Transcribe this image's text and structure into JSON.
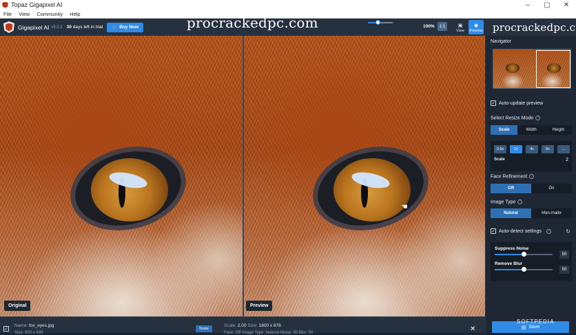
{
  "window": {
    "title": "Topaz Gigapixel AI",
    "controls": [
      "–",
      "▢",
      "✕"
    ]
  },
  "menu": [
    "File",
    "View",
    "Community",
    "Help"
  ],
  "toolbar": {
    "app_name": "Gigapixel AI",
    "version": "v5.0.1",
    "trial_days": "30",
    "trial_rest": "days left in trial",
    "buy_label": "Buy Now",
    "zoom_percent": "100%",
    "zoom_slider_fraction": 0.4,
    "zoom_box_label": "1:1",
    "view_label": "View",
    "preview_label": "Preview"
  },
  "watermark": "procrackedpc.com",
  "panes": {
    "original_label": "Original",
    "preview_label": "Preview"
  },
  "sidebar": {
    "navigator_title": "Navigator",
    "auto_update_label": "Auto-update preview",
    "resize_mode_title": "Select Resize Mode",
    "resize_modes": [
      "Scale",
      "Width",
      "Height"
    ],
    "scale_options": [
      "0.5x",
      "2x",
      "4x",
      "6x",
      "..."
    ],
    "scale_label": "Scale",
    "scale_value": "2",
    "face_title": "Face Refinement",
    "face_options": [
      "Off",
      "On"
    ],
    "image_type_title": "Image Type",
    "image_type_options": [
      "Natural",
      "Man-made"
    ],
    "auto_detect_label": "Auto-detect settings",
    "suppress_noise_label": "Suppress Noise",
    "suppress_noise_value": "50",
    "remove_blur_label": "Remove Blur",
    "remove_blur_value": "50",
    "slider_fraction": 0.5,
    "save_label": "Save"
  },
  "bottom": {
    "name_key": "Name:",
    "name_value": "fox_eyes.jpg",
    "size_line": "Size: 900 x 439",
    "scale_button": "Scale",
    "scale_key": "Scale:",
    "scale_value": "2.00",
    "size_key": "Size:",
    "size_value": "1800 x 878",
    "info_line": "Face: Off  Image Type: Natural  Noise: 50  Blur: 50"
  },
  "softpedia": "SOFTPEDIA",
  "colors": {
    "accent": "#2f8be6",
    "panel": "#1e2733",
    "toolbar": "#263140"
  }
}
